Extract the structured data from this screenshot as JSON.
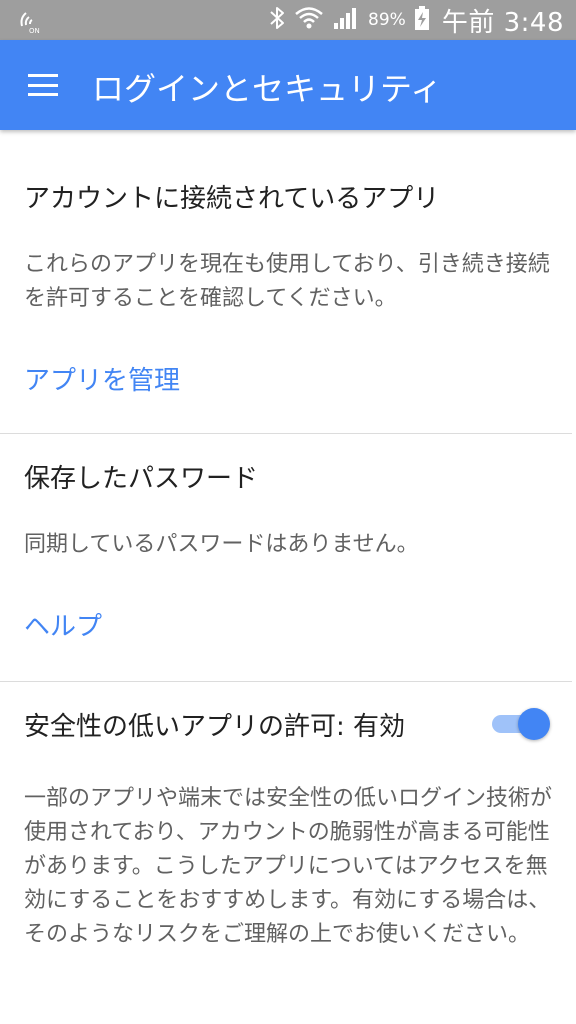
{
  "status_bar": {
    "battery_percent": "89%",
    "time": "午前 3:48",
    "icons": [
      "nfc-icon",
      "bluetooth-icon",
      "wifi-icon",
      "signal-icon",
      "battery-charging-icon"
    ]
  },
  "app_bar": {
    "title": "ログインとセキュリティ",
    "menu_icon": "hamburger-menu-icon",
    "background": "#4285f4"
  },
  "sections": {
    "connected_apps": {
      "title": "アカウントに接続されているアプリ",
      "description": "これらのアプリを現在も使用しており、引き続き接続を許可することを確認してください。",
      "link": "アプリを管理"
    },
    "saved_passwords": {
      "title": "保存したパスワード",
      "description": "同期しているパスワードはありません。",
      "link": "ヘルプ"
    },
    "less_secure_apps": {
      "title": "安全性の低いアプリの許可: 有効",
      "toggle_on": true,
      "description": "一部のアプリや端末では安全性の低いログイン技術が使用されており、アカウントの脆弱性が高まる可能性があります。こうしたアプリについてはアクセスを無効にすることをおすすめします。有効にする場合は、そのようなリスクをご理解の上でお使いください。"
    }
  },
  "colors": {
    "accent": "#4285f4",
    "status_bar": "#9e9e9e",
    "title_text": "#212121",
    "body_text": "#616161"
  }
}
